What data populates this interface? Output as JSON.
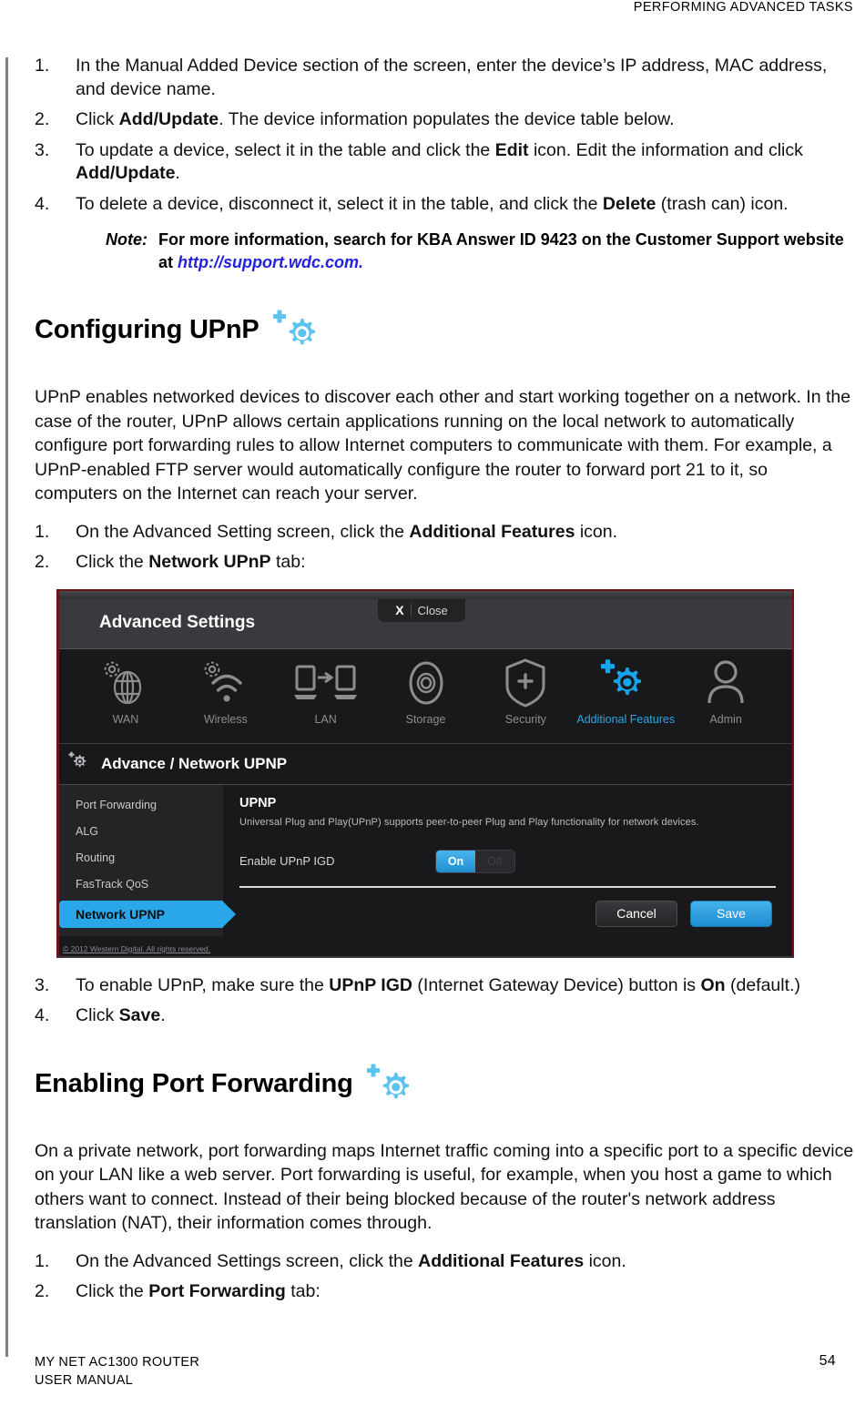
{
  "header": {
    "running_head": "PERFORMING ADVANCED TASKS"
  },
  "steps_top": [
    {
      "num": "1.",
      "html": "In the Manual Added Device section of the screen, enter the device’s IP address, MAC address, and device name."
    },
    {
      "num": "2.",
      "html": "Click <b>Add/Update</b>. The device information populates the device table below."
    },
    {
      "num": "3.",
      "html": "To update a device, select it in the table and click the <b>Edit</b> icon. Edit the information and click <b>Add/Update</b>."
    },
    {
      "num": "4.",
      "html": "To delete a device, disconnect it, select it in the table, and click the <b>Delete</b> (trash can) icon."
    }
  ],
  "note": {
    "label": "Note:",
    "text_before": "For more information, search for KBA Answer ID 9423 on the Customer Support website at ",
    "url": "http://support.wdc.com.",
    "url_color": "#2222dd"
  },
  "section_upnp": {
    "heading": "Configuring UPnP",
    "icon": "additional-features-gear-plus-icon",
    "icon_color": "#5cc2f0",
    "paragraph": "UPnP enables networked devices to discover each other and start working together on a network. In the case of the router, UPnP allows certain applications running on the local network to automatically configure port forwarding rules to allow Internet computers to communicate with them. For example, a UPnP-enabled FTP server would automatically configure the router to forward port 21 to it, so computers on the Internet can reach your server.",
    "steps_before": [
      {
        "num": "1.",
        "html": "On the Advanced Setting screen, click the <b>Additional Features</b> icon."
      },
      {
        "num": "2.",
        "html": "Click the <b>Network UPnP</b> tab:"
      }
    ],
    "steps_after": [
      {
        "num": "3.",
        "html": "To enable UPnP, make sure the <b>UPnP IGD</b> (Internet Gateway Device) button is <b>On</b> (default.)"
      },
      {
        "num": "4.",
        "html": "Click <b>Save</b>."
      }
    ]
  },
  "figure": {
    "title": "Advanced Settings",
    "close_label": "Close",
    "close_x": "X",
    "nav": [
      {
        "label": "WAN",
        "icon": "globe-gear-icon",
        "active": false
      },
      {
        "label": "Wireless",
        "icon": "wifi-gear-icon",
        "active": false
      },
      {
        "label": "LAN",
        "icon": "device-to-device-icon",
        "active": false
      },
      {
        "label": "Storage",
        "icon": "disc-icon",
        "active": false
      },
      {
        "label": "Security",
        "icon": "shield-plus-icon",
        "active": false
      },
      {
        "label": "Additional Features",
        "icon": "gear-plus-icon",
        "active": true
      },
      {
        "label": "Admin",
        "icon": "person-icon",
        "active": false
      }
    ],
    "breadcrumb": "Advance / Network UPNP",
    "breadcrumb_icon": "gear-plus-small-icon",
    "sidebar": [
      {
        "label": "Port Forwarding",
        "active": false
      },
      {
        "label": "ALG",
        "active": false
      },
      {
        "label": "Routing",
        "active": false
      },
      {
        "label": "FasTrack QoS",
        "active": false
      },
      {
        "label": "Network UPNP",
        "active": true
      }
    ],
    "panel": {
      "heading": "UPNP",
      "description": "Universal Plug and Play(UPnP) supports peer-to-peer Plug and Play functionality for network devices.",
      "field_label": "Enable UPnP IGD",
      "toggle_on_label": "On",
      "toggle_off_label": "Off",
      "toggle_state": "On"
    },
    "buttons": {
      "cancel": "Cancel",
      "save": "Save"
    },
    "copyright": "© 2012 Western Digital. All rights reserved.",
    "accent_color": "#2aa7e8"
  },
  "section_port_forwarding": {
    "heading": "Enabling Port Forwarding",
    "icon": "additional-features-gear-plus-icon",
    "icon_color": "#5cc2f0",
    "paragraph": "On a private network, port forwarding maps Internet traffic coming into a specific port to a specific device on your LAN like a web server. Port forwarding is useful, for example, when you host a game to which others want to connect. Instead of their being blocked because of the router's network address translation (NAT), their information comes through.",
    "steps": [
      {
        "num": "1.",
        "html": "On the Advanced Settings screen, click the <b>Additional Features</b> icon."
      },
      {
        "num": "2.",
        "html": "Click the <b>Port Forwarding</b> tab:"
      }
    ]
  },
  "footer": {
    "line1": "MY NET AC1300 ROUTER",
    "line2": "USER MANUAL",
    "page_number": "54"
  }
}
